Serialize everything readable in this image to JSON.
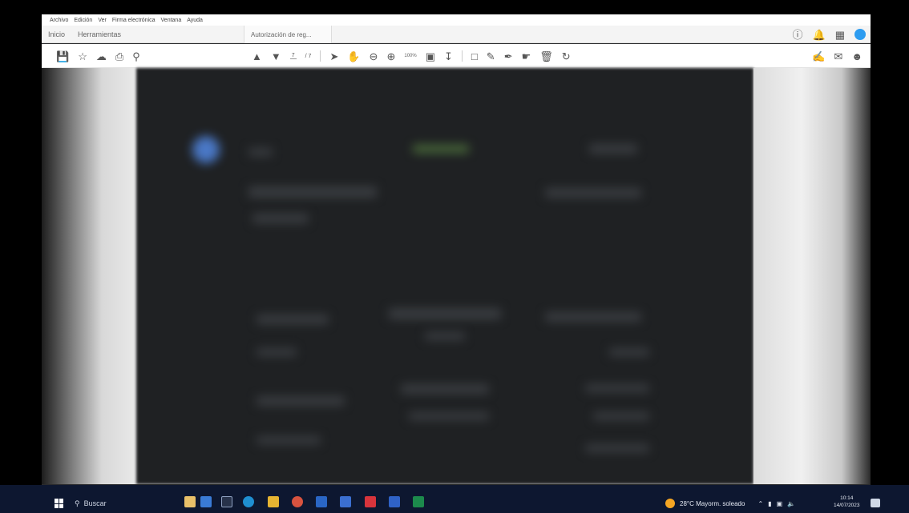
{
  "menu": [
    "Archivo",
    "Edición",
    "Ver",
    "Firma electrónica",
    "Ventana",
    "Ayuda"
  ],
  "tabs": {
    "home": "Inicio",
    "tools": "Herramientas",
    "document": "Autorización de reg..."
  },
  "toolbar": {
    "page_current": "7",
    "page_total": "/ 7",
    "zoom": "100%"
  },
  "taskbar": {
    "search_placeholder": "Buscar",
    "weather": "28°C  Mayorm. soleado",
    "time": "10:14",
    "date": "14/07/2023"
  },
  "colors": {
    "accent": "#2d9cf0",
    "taskbar": "#0d1730",
    "page": "#1f2123"
  }
}
